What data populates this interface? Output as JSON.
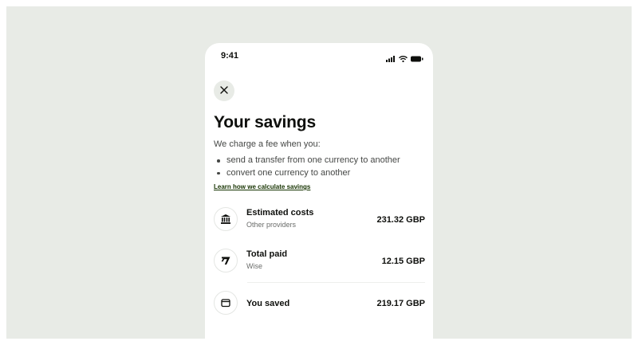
{
  "status_bar": {
    "time": "9:41"
  },
  "header": {
    "title": "Your savings"
  },
  "intro": "We charge a fee when you:",
  "bullets": [
    "send a transfer from one currency to another",
    "convert one currency to another"
  ],
  "learn_link": "Learn how we calculate savings",
  "rows": [
    {
      "title": "Estimated costs",
      "subtitle": "Other providers",
      "amount": "231.32 GBP",
      "icon": "bank-icon"
    },
    {
      "title": "Total paid",
      "subtitle": "Wise",
      "amount": "12.15 GBP",
      "icon": "wise-logo-icon"
    },
    {
      "title": "You saved",
      "amount": "219.17 GBP",
      "icon": "wallet-icon"
    }
  ],
  "colors": {
    "background": "#e8ebe6",
    "text": "#0e0f0c",
    "link": "#163300"
  }
}
